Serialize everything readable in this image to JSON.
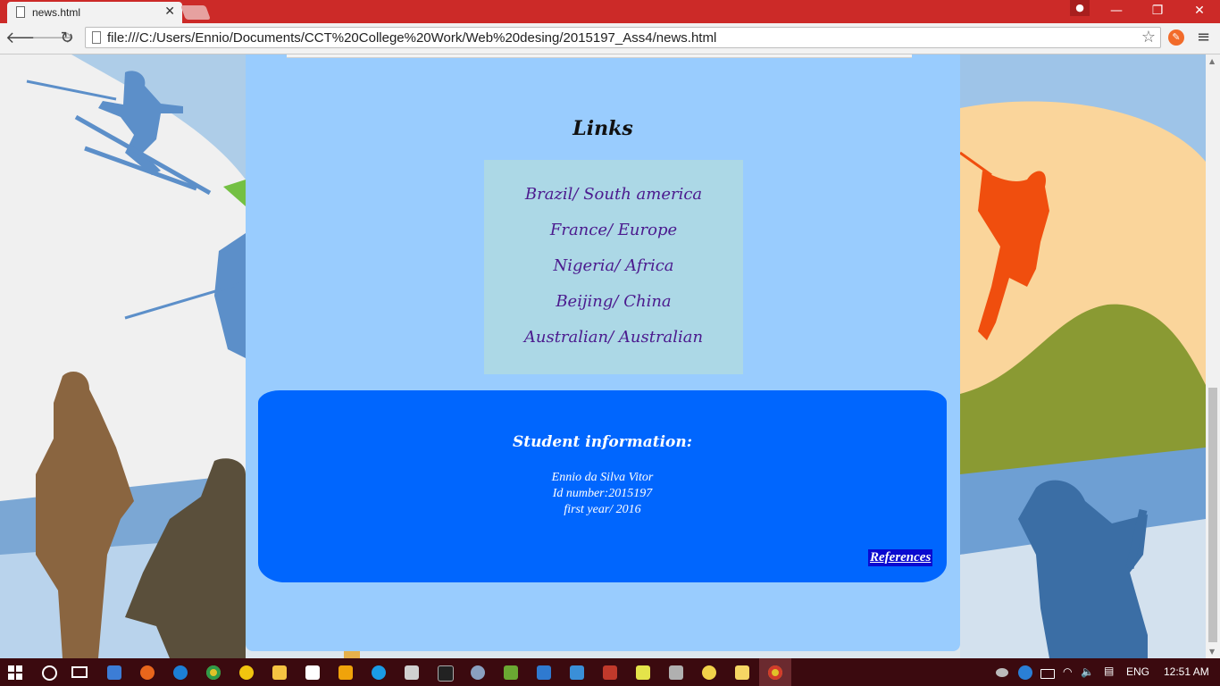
{
  "browser": {
    "tab_title": "news.html",
    "tab_close": "✕",
    "url": "file:///C:/Users/Ennio/Documents/CCT%20College%20Work/Web%20desing/2015197_Ass4/news.html",
    "back_icon": "🡐",
    "forward_icon": "🡒",
    "reload_icon": "↻",
    "star_icon": "☆",
    "menu_icon": "≡",
    "minimize": "—",
    "restore": "❐",
    "close": "✕"
  },
  "page": {
    "links_heading": "Links",
    "links": [
      "Brazil/ South america",
      "France/ Europe",
      "Nigeria/ Africa",
      "Beijing/ China",
      "Australian/ Australian"
    ],
    "student": {
      "title": "Student information:",
      "name": "Ennio da Silva Vitor",
      "id": "Id number:2015197",
      "year": "first year/ 2016",
      "references": "References"
    }
  },
  "taskbar": {
    "language": "ENG",
    "time": "12:51 AM"
  },
  "colors": {
    "panel": "#99ccfe",
    "links_box": "#acd8e6",
    "student_box": "#0066fe",
    "link_text": "#4b1a8e",
    "title_bar": "#cc2a28",
    "taskbar": "#3b0a0f"
  }
}
